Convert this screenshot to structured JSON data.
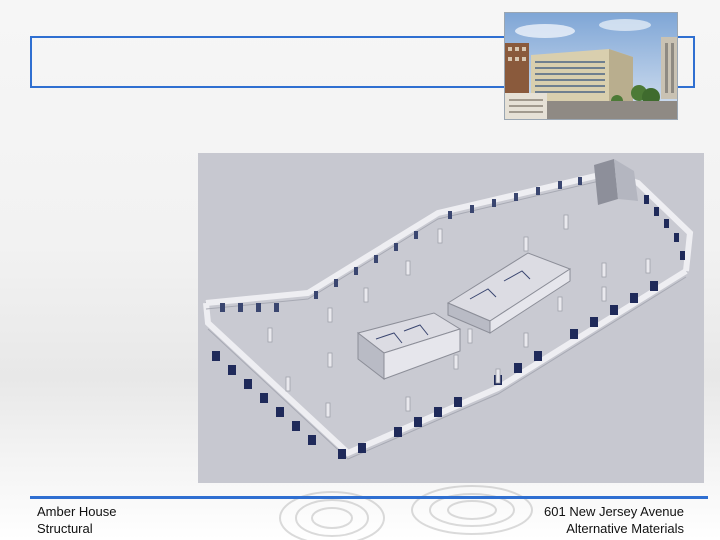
{
  "slide": {
    "title": "",
    "footer_left_line1": "Amber House",
    "footer_left_line2": "Structural",
    "footer_right_line1": "601 New Jersey Avenue",
    "footer_right_line2": "Alternative Materials",
    "accent_color": "#2f6fd1"
  },
  "images": {
    "building_photo_icon": "building-photo",
    "floor_plan_icon": "3d-floor-plan-model"
  }
}
